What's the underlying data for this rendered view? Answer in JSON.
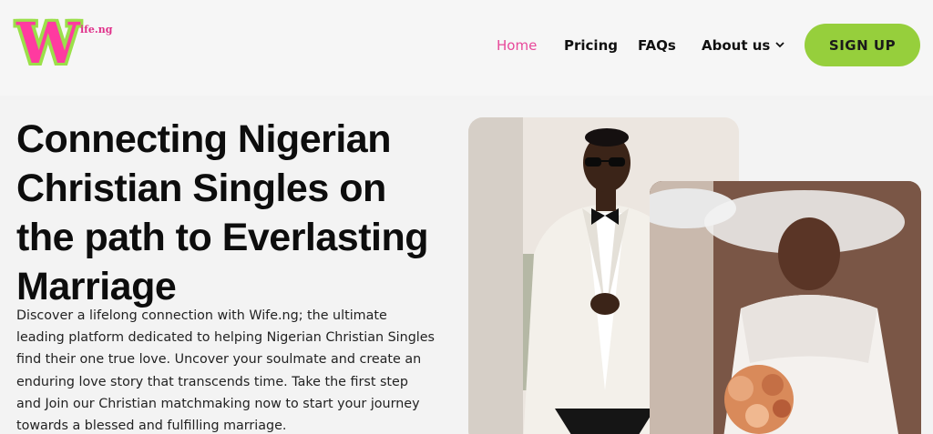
{
  "brand": {
    "logo_letter": "W",
    "logo_text": "ife.ng",
    "accent": "#ff3aa0",
    "secondary": "#9be04a"
  },
  "nav": {
    "home": "Home",
    "pricing": "Pricing",
    "faqs": "FAQs",
    "about": "About us",
    "signup": "SIGN UP"
  },
  "hero": {
    "title": "Connecting Nigerian Christian Singles on the path to Everlasting Marriage",
    "description": "Discover a lifelong connection with Wife.ng; the ultimate leading platform dedicated to helping Nigerian Christian Singles find their one true love. Uncover your soulmate and create an enduring love story that transcends time. Take the first step and Join our Christian matchmaking now to start your journey towards a blessed and fulfilling marriage."
  },
  "icons": {
    "about_dropdown": "chevron-down-icon"
  }
}
